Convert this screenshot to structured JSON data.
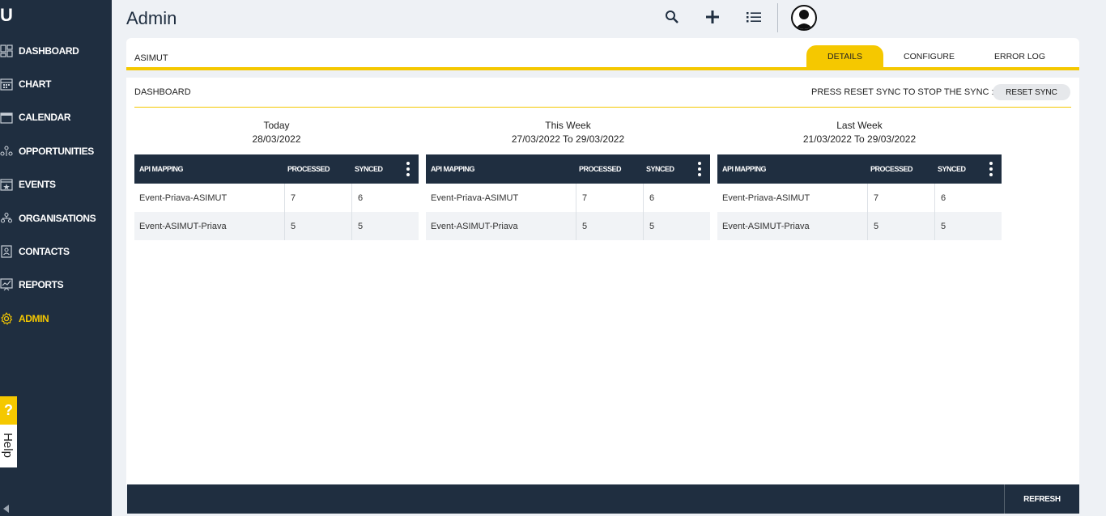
{
  "app": {
    "logo_text": "U"
  },
  "sidebar": {
    "items": [
      {
        "label": "DASHBOARD",
        "icon": "dashboard-icon"
      },
      {
        "label": "CHART",
        "icon": "chart-icon"
      },
      {
        "label": "CALENDAR",
        "icon": "calendar-icon"
      },
      {
        "label": "OPPORTUNITIES",
        "icon": "opportunities-icon"
      },
      {
        "label": "EVENTS",
        "icon": "events-icon"
      },
      {
        "label": "ORGANISATIONS",
        "icon": "organisations-icon"
      },
      {
        "label": "CONTACTS",
        "icon": "contacts-icon"
      },
      {
        "label": "REPORTS",
        "icon": "reports-icon"
      },
      {
        "label": "ADMIN",
        "icon": "gear-icon",
        "active": true
      }
    ],
    "help": {
      "q": "?",
      "label": "Help"
    }
  },
  "header": {
    "title": "Admin",
    "icons": [
      "search-icon",
      "plus-icon",
      "list-icon",
      "user-avatar-icon"
    ]
  },
  "tabbar": {
    "module": "ASIMUT",
    "tabs": [
      {
        "label": "DETAILS",
        "active": true
      },
      {
        "label": "CONFIGURE",
        "active": false
      },
      {
        "label": "ERROR LOG",
        "active": false
      }
    ]
  },
  "panel": {
    "label": "DASHBOARD",
    "sync_text": "PRESS RESET SYNC TO STOP THE SYNC :",
    "reset_label": "RESET SYNC"
  },
  "groups": [
    {
      "title": "Today",
      "range": "28/03/2022",
      "headers": [
        "API MAPPING",
        "PROCESSED",
        "SYNCED"
      ],
      "rows": [
        [
          "Event-Priava-ASIMUT",
          "7",
          "6"
        ],
        [
          "Event-ASIMUT-Priava",
          "5",
          "5"
        ]
      ]
    },
    {
      "title": "This Week",
      "range": "27/03/2022 To 29/03/2022",
      "headers": [
        "API MAPPING",
        "PROCESSED",
        "SYNCED"
      ],
      "rows": [
        [
          "Event-Priava-ASIMUT",
          "7",
          "6"
        ],
        [
          "Event-ASIMUT-Priava",
          "5",
          "5"
        ]
      ]
    },
    {
      "title": "Last Week",
      "range": "21/03/2022 To 29/03/2022",
      "headers": [
        "API MAPPING",
        "PROCESSED",
        "SYNCED"
      ],
      "rows": [
        [
          "Event-Priava-ASIMUT",
          "7",
          "6"
        ],
        [
          "Event-ASIMUT-Priava",
          "5",
          "5"
        ]
      ]
    }
  ],
  "footer": {
    "refresh_label": "REFRESH"
  },
  "colors": {
    "sidebar": "#1f2e40",
    "accent": "#f5c800",
    "panel": "#ffffff",
    "background": "#eef1f5"
  }
}
